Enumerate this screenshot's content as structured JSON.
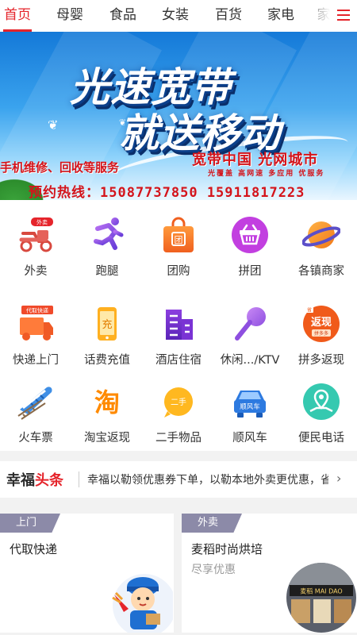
{
  "topnav": {
    "tabs": [
      "首页",
      "母婴",
      "食品",
      "女装",
      "百货",
      "家电",
      "家"
    ],
    "active_index": 0,
    "accent_color": "#e5242b",
    "menu_icon": "hamburger-menu-icon"
  },
  "banner": {
    "headline_1": "光速宽带",
    "headline_2": "就送移动",
    "slogan": "宽带中国 光网城市",
    "tagline": "光覆盖 高网速 多应用 优服务",
    "service": "手机维修、回收等服务",
    "hotline": "预约热线：15087737850  15911817223"
  },
  "grid": {
    "items": [
      {
        "label": "外卖",
        "icon": "scooter-icon"
      },
      {
        "label": "跑腿",
        "icon": "running-man-icon"
      },
      {
        "label": "团购",
        "icon": "shopping-bag-icon"
      },
      {
        "label": "拼团",
        "icon": "basket-icon"
      },
      {
        "label": "各镇商家",
        "icon": "planet-icon"
      },
      {
        "label": "快递上门",
        "icon": "delivery-truck-icon"
      },
      {
        "label": "话费充值",
        "icon": "phone-recharge-icon"
      },
      {
        "label": "酒店住宿",
        "icon": "hotel-icon"
      },
      {
        "label": "休闲.../KTV",
        "icon": "microphone-icon"
      },
      {
        "label": "拼多返现",
        "icon": "cashback-icon"
      },
      {
        "label": "火车票",
        "icon": "train-icon"
      },
      {
        "label": "淘宝返现",
        "icon": "taobao-icon"
      },
      {
        "label": "二手物品",
        "icon": "secondhand-icon"
      },
      {
        "label": "顺风车",
        "icon": "car-icon"
      },
      {
        "label": "便民电话",
        "icon": "map-pin-icon"
      }
    ],
    "badges": {
      "waimai": "外卖",
      "express": "代取快递",
      "recharge": "充",
      "tuangou": "团",
      "taobao": "淘",
      "secondhand": "二手",
      "carpool": "顺风车",
      "cashback": "返现",
      "cashback_small": "拼多多",
      "cashback_top": "省"
    }
  },
  "news": {
    "logo_a": "幸福",
    "logo_b": "头条",
    "text": "幸福以勒领优惠券下单，以勒本地外卖更优惠，省钱",
    "chevron": "›"
  },
  "cards": [
    {
      "tag": "上门",
      "title": "代取快递",
      "subtitle": ""
    },
    {
      "tag": "外卖",
      "title": "麦稻时尚烘培",
      "subtitle": "尽享优惠",
      "photo_sign": "麦稻 MAI DAO"
    }
  ]
}
